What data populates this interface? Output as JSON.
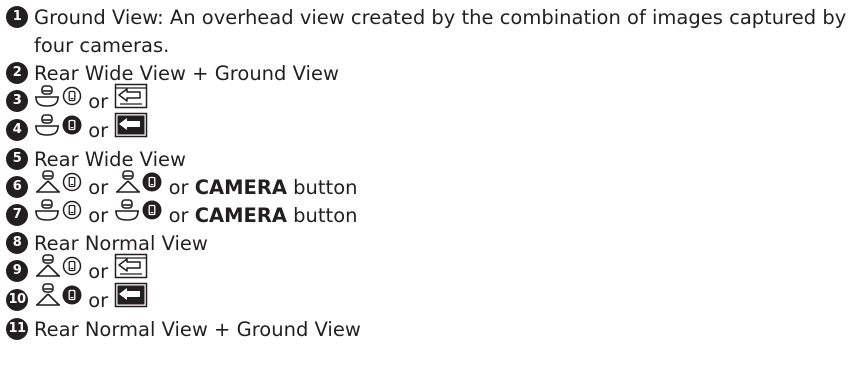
{
  "items": [
    {
      "num": "1",
      "text": "Ground View: An overhead view created by the combination of images captured by four cameras."
    },
    {
      "num": "2",
      "text": "Rear Wide View + Ground View"
    },
    {
      "num": "3",
      "or1": "or"
    },
    {
      "num": "4",
      "or1": "or"
    },
    {
      "num": "5",
      "text": "Rear Wide View"
    },
    {
      "num": "6",
      "or1": "or",
      "or2": "or",
      "button_bold": "CAMERA",
      "button_rest": "button"
    },
    {
      "num": "7",
      "or1": "or",
      "or2": "or",
      "button_bold": "CAMERA",
      "button_rest": "button"
    },
    {
      "num": "8",
      "text": "Rear Normal View"
    },
    {
      "num": "9",
      "or1": "or"
    },
    {
      "num": "10",
      "or1": "or"
    },
    {
      "num": "11",
      "text": "Rear Normal View + Ground View"
    }
  ],
  "icons": {
    "camera_top": "overhead-camera-icon",
    "camera_person": "camera-person-icon",
    "switch_outline": "camera-switch-outline-icon",
    "switch_filled": "camera-switch-filled-icon",
    "phone_outline": "phone-outline-icon",
    "phone_filled": "phone-filled-icon"
  }
}
